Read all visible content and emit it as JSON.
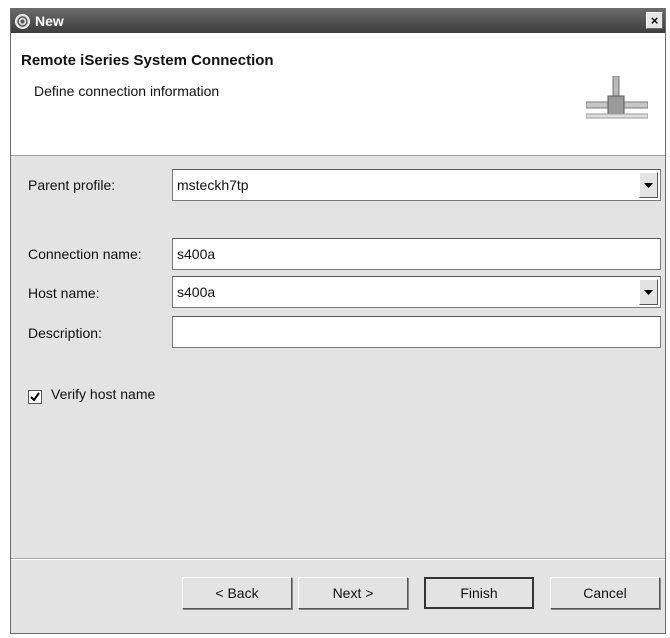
{
  "window": {
    "title": "New",
    "close_glyph": "×"
  },
  "banner": {
    "title": "Remote iSeries System Connection",
    "description": "Define connection information",
    "graphic_icon": "connection-icon"
  },
  "form": {
    "parent_profile": {
      "label": "Parent profile:",
      "value": "msteckh7tp"
    },
    "connection_name": {
      "label": "Connection name:",
      "value": "s400a"
    },
    "host_name": {
      "label": "Host name:",
      "value": "s400a"
    },
    "description": {
      "label": "Description:",
      "value": ""
    },
    "verify_host": {
      "label": "Verify host name",
      "checked": true
    }
  },
  "buttons": {
    "back": "< Back",
    "next": "Next >",
    "finish": "Finish",
    "cancel": "Cancel"
  }
}
